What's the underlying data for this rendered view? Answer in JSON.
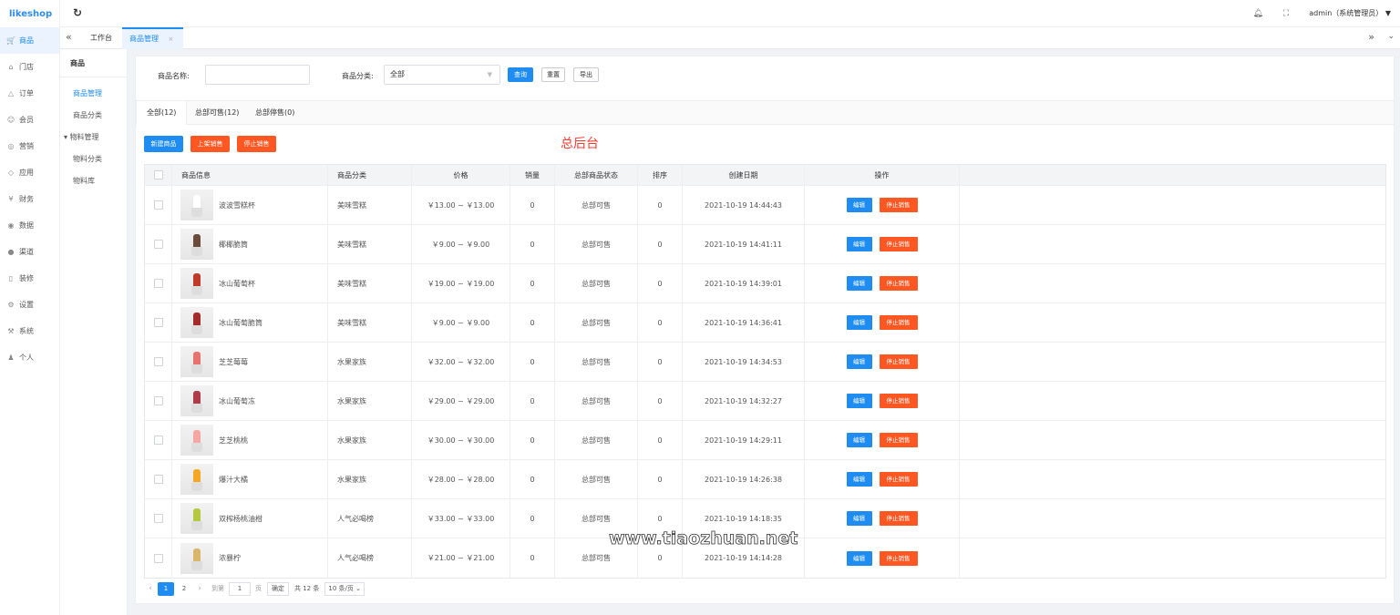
{
  "logo": "likeshop",
  "nav": [
    {
      "icon": "cart-icon",
      "glyph": "🛒",
      "label": "商品",
      "active": true
    },
    {
      "icon": "store-icon",
      "glyph": "⌂",
      "label": "门店"
    },
    {
      "icon": "bell-icon",
      "glyph": "△",
      "label": "订单"
    },
    {
      "icon": "user-icon",
      "glyph": "☺",
      "label": "会员"
    },
    {
      "icon": "marketing-icon",
      "glyph": "◎",
      "label": "营销"
    },
    {
      "icon": "shield-icon",
      "glyph": "◇",
      "label": "应用"
    },
    {
      "icon": "finance-icon",
      "glyph": "¥",
      "label": "财务"
    },
    {
      "icon": "data-icon",
      "glyph": "◉",
      "label": "数据"
    },
    {
      "icon": "channel-icon",
      "glyph": "●",
      "label": "渠道"
    },
    {
      "icon": "decorate-icon",
      "glyph": "▯",
      "label": "装修"
    },
    {
      "icon": "gear-icon",
      "glyph": "⚙",
      "label": "设置"
    },
    {
      "icon": "system-icon",
      "glyph": "⚒",
      "label": "系统"
    },
    {
      "icon": "person-icon",
      "glyph": "♟",
      "label": "个人"
    }
  ],
  "topbar": {
    "user": "admin（系统管理员）",
    "user_caret": "▼"
  },
  "tabs": {
    "work": "工作台",
    "current": "商品管理",
    "close": "×"
  },
  "subnav": {
    "title": "商品",
    "items": [
      "商品管理",
      "商品分类"
    ],
    "group": "物料管理",
    "group_items": [
      "物料分类",
      "物料库"
    ]
  },
  "filter": {
    "name_label": "商品名称:",
    "name_value": "",
    "category_label": "商品分类:",
    "category_value": "全部",
    "query": "查询",
    "reset": "重置",
    "export": "导出"
  },
  "inner_tabs": [
    "全部(12)",
    "总部可售(12)",
    "总部停售(0)"
  ],
  "actions": {
    "new": "新建商品",
    "on_sale": "上架销售",
    "stop": "停止销售"
  },
  "headline": "总后台",
  "table": {
    "headers": [
      "商品信息",
      "商品分类",
      "价格",
      "销量",
      "总部商品状态",
      "排序",
      "创建日期",
      "操作"
    ],
    "edit_label": "编辑",
    "stop_label": "停止销售",
    "rows": [
      {
        "name": "波波雪糕杯",
        "category": "美味雪糕",
        "price": "￥13.00 ~ ￥13.00",
        "sales": "0",
        "status": "总部可售",
        "sort": "0",
        "date": "2021-10-19 14:44:43",
        "color": "#ffffff"
      },
      {
        "name": "椰椰脆筒",
        "category": "美味雪糕",
        "price": "￥9.00 ~ ￥9.00",
        "sales": "0",
        "status": "总部可售",
        "sort": "0",
        "date": "2021-10-19 14:41:11",
        "color": "#6b4b3a"
      },
      {
        "name": "冰山葡萄杯",
        "category": "美味雪糕",
        "price": "￥19.00 ~ ￥19.00",
        "sales": "0",
        "status": "总部可售",
        "sort": "0",
        "date": "2021-10-19 14:39:01",
        "color": "#c0392b"
      },
      {
        "name": "冰山葡萄脆筒",
        "category": "美味雪糕",
        "price": "￥9.00 ~ ￥9.00",
        "sales": "0",
        "status": "总部可售",
        "sort": "0",
        "date": "2021-10-19 14:36:41",
        "color": "#a52a2a"
      },
      {
        "name": "芝芝莓莓",
        "category": "水果家族",
        "price": "￥32.00 ~ ￥32.00",
        "sales": "0",
        "status": "总部可售",
        "sort": "0",
        "date": "2021-10-19 14:34:53",
        "color": "#e8726e"
      },
      {
        "name": "冰山葡萄冻",
        "category": "水果家族",
        "price": "￥29.00 ~ ￥29.00",
        "sales": "0",
        "status": "总部可售",
        "sort": "0",
        "date": "2021-10-19 14:32:27",
        "color": "#b03a48"
      },
      {
        "name": "芝芝桃桃",
        "category": "水果家族",
        "price": "￥30.00 ~ ￥30.00",
        "sales": "0",
        "status": "总部可售",
        "sort": "0",
        "date": "2021-10-19 14:29:11",
        "color": "#f4a7a3"
      },
      {
        "name": "爆汁大橘",
        "category": "水果家族",
        "price": "￥28.00 ~ ￥28.00",
        "sales": "0",
        "status": "总部可售",
        "sort": "0",
        "date": "2021-10-19 14:26:38",
        "color": "#f5a623"
      },
      {
        "name": "双榨杨桃油柑",
        "category": "人气必喝榜",
        "price": "￥33.00 ~ ￥33.00",
        "sales": "0",
        "status": "总部可售",
        "sort": "0",
        "date": "2021-10-19 14:18:35",
        "color": "#b5c940"
      },
      {
        "name": "浓暴柠",
        "category": "人气必喝榜",
        "price": "￥21.00 ~ ￥21.00",
        "sales": "0",
        "status": "总部可售",
        "sort": "0",
        "date": "2021-10-19 14:14:28",
        "color": "#d9b66a"
      }
    ]
  },
  "pager": {
    "prev": "‹",
    "pages": [
      "1",
      "2"
    ],
    "next": "›",
    "goto": "到第",
    "goto_value": "1",
    "page_unit": "页",
    "ok": "确定",
    "total": "共 12 条",
    "size": "10 条/页 ⌄"
  },
  "watermark": "www.tiaozhuan.net",
  "colors": {
    "primary": "#1e8cf0",
    "orange": "#ff5722",
    "headline": "#ff3b30"
  }
}
